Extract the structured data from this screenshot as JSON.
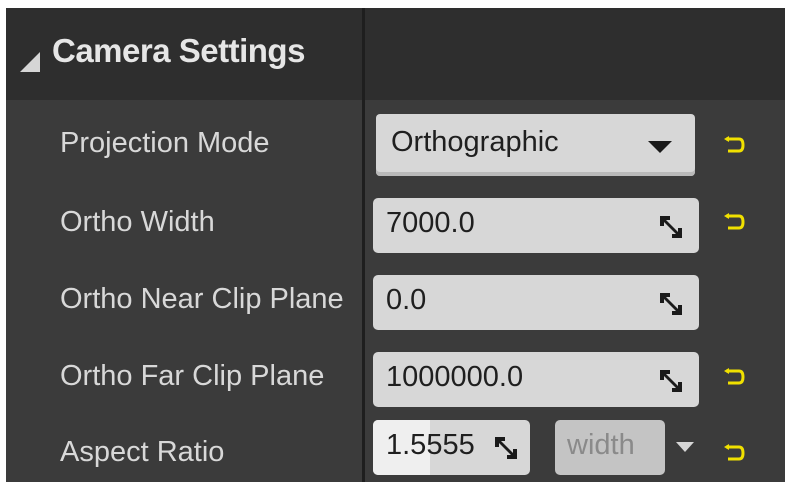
{
  "section": {
    "title": "Camera Settings"
  },
  "properties": [
    {
      "label": "Projection Mode",
      "value": "Orthographic"
    },
    {
      "label": "Ortho Width",
      "value": "7000.0"
    },
    {
      "label": "Ortho Near Clip Plane",
      "value": "0.0"
    },
    {
      "label": "Ortho Far Clip Plane",
      "value": "1000000.0"
    },
    {
      "label": "Aspect Ratio",
      "value": "1.5555",
      "constraint": "width",
      "fill_fraction": 0.36
    }
  ],
  "icons": {
    "section_toggle": "expanded-triangle-icon",
    "dropdown": "dropdown-arrow-icon",
    "drag": "drag-arrows-icon",
    "reset": "reset-to-default-icon"
  },
  "colors": {
    "panel_bg": "#3b3b3b",
    "header_bg": "#2e2e2e",
    "label_text": "#d8d8d8",
    "field_bg": "#d7d7d7",
    "reset_icon": "#f0e000"
  }
}
